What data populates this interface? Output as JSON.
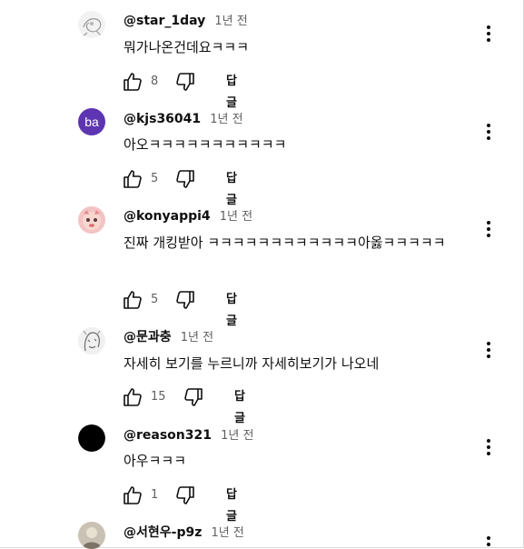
{
  "comments": [
    {
      "handle": "@star_1day",
      "time": "1년 전",
      "text": "뭐가나온건데요ㅋㅋㅋ",
      "likes": "8",
      "reply_label": "답글",
      "avatar": "sketch-avatar"
    },
    {
      "handle": "@kjs36041",
      "time": "1년 전",
      "text": "아오ㅋㅋㅋㅋㅋㅋㅋㅋㅋㅋㅋ",
      "likes": "5",
      "reply_label": "답글",
      "avatar": "initials-avatar",
      "initials": "ba",
      "avatar_color": "#5e35b1"
    },
    {
      "handle": "@konyappi4",
      "time": "1년 전",
      "text": "진짜 개킹받아 ㅋㅋㅋㅋㅋㅋㅋㅋㅋㅋㅋㅋ아옳ㅋㅋㅋㅋㅋ",
      "likes": "5",
      "reply_label": "답글",
      "avatar": "character-avatar"
    },
    {
      "handle": "@문과충",
      "time": "1년 전",
      "text": "자세히 보기를 누르니까 자세히보기가 나오네",
      "likes": "15",
      "reply_label": "답글",
      "avatar": "sketch-avatar"
    },
    {
      "handle": "@reason321",
      "time": "1년 전",
      "text": "아우ㅋㅋㅋ",
      "likes": "1",
      "reply_label": "답글",
      "avatar": "black-avatar"
    },
    {
      "handle": "@서현우-p9z",
      "time": "1년 전",
      "avatar": "photo-avatar"
    }
  ]
}
